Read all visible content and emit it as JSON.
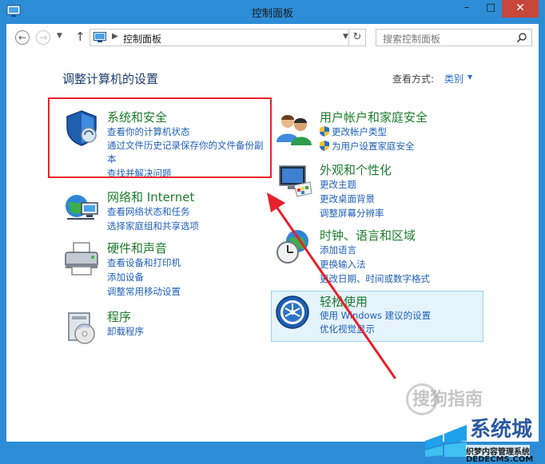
{
  "window": {
    "title": "控制面板",
    "minimize_glyph": "–",
    "maximize_glyph": "□",
    "close_glyph": "✕"
  },
  "addressbar": {
    "path": "控制面板",
    "search_placeholder": "搜索控制面板"
  },
  "page": {
    "heading": "调整计算机的设置",
    "view_by_label": "查看方式:",
    "view_by_value": "类别"
  },
  "categories": {
    "security": {
      "title": "系统和安全",
      "links": [
        "查看你的计算机状态",
        "通过文件历史记录保存你的文件备份副",
        "本",
        "查找并解决问题"
      ]
    },
    "network": {
      "title": "网络和 Internet",
      "links": [
        "查看网络状态和任务",
        "选择家庭组和共享选项"
      ]
    },
    "hardware": {
      "title": "硬件和声音",
      "links": [
        "查看设备和打印机",
        "添加设备",
        "调整常用移动设置"
      ]
    },
    "programs": {
      "title": "程序",
      "links": [
        "卸载程序"
      ]
    },
    "user_accounts": {
      "title": "用户帐户和家庭安全",
      "links": [
        "更改帐户类型",
        "为用户设置家庭安全"
      ]
    },
    "appearance": {
      "title": "外观和个性化",
      "links": [
        "更改主题",
        "更改桌面背景",
        "调整屏幕分辨率"
      ]
    },
    "clock": {
      "title": "时钟、语言和区域",
      "links": [
        "添加语言",
        "更换输入法",
        "更改日期、时间或数字格式"
      ]
    },
    "ease": {
      "title": "轻松使用",
      "links": [
        "使用 Windows 建议的设置",
        "优化视觉显示"
      ]
    }
  },
  "watermarks": {
    "sogou": "搜狗指南",
    "brand": "系统城",
    "site_line1": "织梦内容管理系统",
    "site_line2": "DEDECMS.COM"
  },
  "colors": {
    "title_bar": "#2c8dd6",
    "category_title": "#1e7c2e",
    "link": "#2060b8",
    "highlight": "#e8202a",
    "close_button": "#c7473b"
  },
  "icons": [
    "control-panel-icon",
    "search-icon",
    "back-icon",
    "forward-icon",
    "up-arrow-icon",
    "refresh-icon",
    "shield-icon",
    "network-globe-icon",
    "printer-icon",
    "programs-icon",
    "users-icon",
    "monitor-palette-icon",
    "clock-globe-icon",
    "ease-of-access-icon",
    "uac-shield-icon"
  ]
}
